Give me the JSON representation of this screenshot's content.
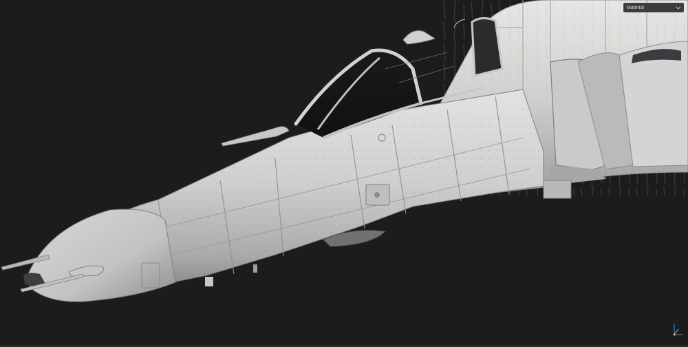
{
  "viewport": {
    "background": "#1c1c1c",
    "shading_menu": {
      "selected": "Material",
      "icon": "chevron-down-icon"
    },
    "axis_gizmo": {
      "icon": "axis-gizmo-icon",
      "colors": {
        "x": "#d8433f",
        "y": "#6fc23a",
        "z": "#3b7fe0"
      }
    },
    "model": {
      "subject": "fighter-jet-nose-cockpit",
      "surface_color": "#cfd0cd",
      "shadow_color": "#8e908d"
    }
  }
}
